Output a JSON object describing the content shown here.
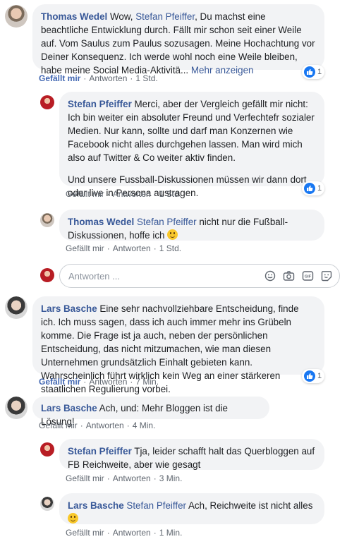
{
  "actions": {
    "like": "Gefällt mir",
    "reply": "Antworten",
    "sep": "·"
  },
  "reply_box": {
    "placeholder": "Antworten ..."
  },
  "comments": [
    {
      "author": "Thomas Wedel",
      "mention": "Stefan Pfeiffer",
      "pre": "Wow, ",
      "text": ", Du machst eine beachtliche Entwicklung durch. Fällt mir schon seit einer Weile auf. Vom Saulus zum Paulus sozusagen. Meine Hochachtung vor Deiner Konsequenz. Ich werde wohl noch eine Weile bleiben, habe meine Social Media-Aktivitä...",
      "more": "Mehr anzeigen",
      "time": "1 Std.",
      "reactions": "1"
    },
    {
      "author": "Stefan Pfeiffer",
      "text": "Merci, aber der Vergleich gefällt mir nicht: Ich bin weiter ein absoluter Freund und Verfechtefr sozialer Medien. Nur kann, sollte und darf man Konzernen wie Facebook nicht alles durchgehen lassen. Man wird mich also auf Twitter & Co weiter aktiv finden.",
      "text2": "Und unsere Fussball-Diskussionen müssen wir dann dort oder live in Persona austragen.",
      "time": "1 Std.",
      "reactions": "1"
    },
    {
      "author": "Thomas Wedel",
      "mention": "Stefan Pfeiffer",
      "text": " nicht nur die Fußball-Diskussionen, hoffe ich ",
      "time": "1 Std."
    },
    {
      "author": "Lars Basche",
      "text": "Eine sehr nachvollziehbare Entscheidung, finde ich. Ich muss sagen, dass ich auch immer mehr ins Grübeln komme. Die Frage ist ja auch, neben der persönlichen Entscheidung, das nicht mitzumachen, wie man diesen Unternehmen grundsätzlich Einhalt gebieten kann. Wahrscheinlich führt wirklich kein Weg an einer stärkeren staatlichen Regulierung vorbei.",
      "time": "7 Min.",
      "reactions": "1"
    },
    {
      "author": "Lars Basche",
      "text": "Ach, und: Mehr Bloggen ist die Lösung!",
      "time": "4 Min."
    },
    {
      "author": "Stefan Pfeiffer",
      "text": "Tja, leider schafft halt das Querbloggen auf FB Reichweite, aber wie gesagt",
      "time": "3 Min."
    },
    {
      "author": "Lars Basche",
      "mention": "Stefan Pfeiffer",
      "text": " Ach, Reichweite ist nicht alles",
      "time": "1 Min."
    }
  ]
}
